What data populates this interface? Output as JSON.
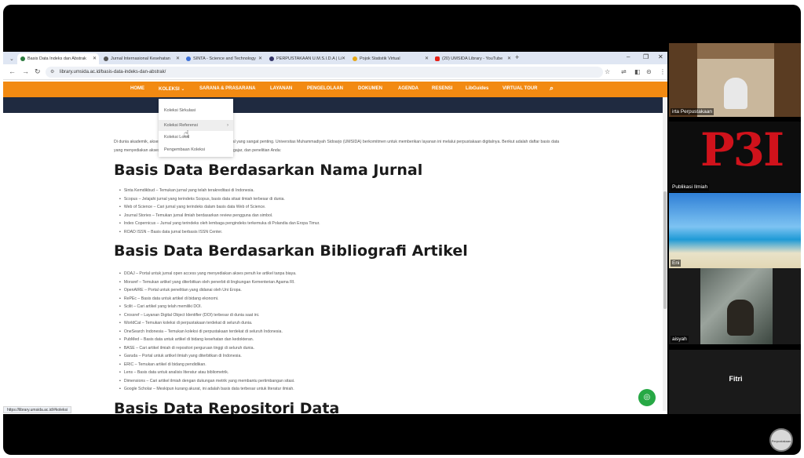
{
  "tabs": [
    {
      "label": "Basis Data Indeks dan Abstrak",
      "active": true,
      "favicon_color": "#2c7a3f"
    },
    {
      "label": "Jurnal Internasional Kesehatan",
      "active": false,
      "favicon_color": "#555555"
    },
    {
      "label": "SINTA - Science and Technology",
      "active": false,
      "favicon_color": "#3a6fd8"
    },
    {
      "label": "PERPUSTAKAAN U.M.S.I.D.A | Li",
      "active": false,
      "favicon_color": "#333366"
    },
    {
      "label": "Pojok Statistik Virtual",
      "active": false,
      "favicon_color": "#e6a817"
    },
    {
      "label": "(20) UMSIDA Library - YouTube",
      "active": false,
      "favicon_color": "#e62117"
    }
  ],
  "address": {
    "url": "library.umsida.ac.id/basis-data-indeks-dan-abstrak/"
  },
  "site": {
    "menu": [
      "HOME",
      "KOLEKSI",
      "SARANA & PRASARANA",
      "LAYANAN",
      "PENGELOLAAN",
      "DOKUMEN",
      "AGENDA",
      "RESENSI",
      "LibGuides",
      "VIRTUAL TOUR"
    ],
    "dropdown": [
      "Koleksi Sirkulasi",
      "Koleksi Referensi",
      "Koleksi Lokal",
      "Pengembaan Koleksi"
    ],
    "intro": "Di dunia akademik, akses terhadap informasi terpercaya adalah hal yang sangat penting. Universitas Muhammadiyah Sidoarjo (UMSIDA) berkomitmen untuk memberikan layanan ini melalui perpustakaan digitalnya. Berikut adalah daftar basis data yang menyediakan akses untuk mendukung kegiatan belajar, mengajar, dan penelitian Anda:",
    "heading1": "Basis Data Berdasarkan Nama Jurnal",
    "list1": [
      "Sinta Kemdikbud – Temukan jurnal yang telah terakreditasi di Indonesia.",
      "Scopus – Jelajahi jurnal yang terindeks Scopus, basis data sitasi ilmiah terbesar di dunia.",
      "Web of Science – Cari jurnal yang terindeks dalam basis data Web of Science.",
      "Journal Stories – Temukan jurnal ilmiah berdasarkan review pengguna dan simbol.",
      "Index Copernicus – Jurnal yang terindeks oleh lembaga pengindeks terkemuka di Polandia dan Eropa Timur.",
      "ROAD ISSN – Basis data jurnal berbasis ISSN Center."
    ],
    "heading2": "Basis Data Berdasarkan Bibliografi Artikel",
    "list2": [
      "DOAJ – Portal untuk jurnal open access yang menyediakan akses penuh ke artikel tanpa biaya.",
      "Moraref – Temukan artikel yang diterbitkan oleh penerbit di lingkungan Kementerian Agama RI.",
      "OpenAIRE – Portal untuk penelitian yang didanai oleh Uni Eropa.",
      "RePEc – Basis data untuk artikel di bidang ekonomi.",
      "Scilit – Cari artikel yang telah memiliki DOI.",
      "Crossref – Layanan Digital Object Identifier (DOI) terbesar di dunia saat ini.",
      "WorldCat – Temukan koleksi di perpustakaan terdekat di seluruh dunia.",
      "OneSearch Indonesia – Temukan koleksi di perpustakaan terdekat di seluruh Indonesia.",
      "PubMed – Basis data untuk artikel di bidang kesehatan dan kedokteran.",
      "BASE – Cari artikel ilmiah di repositori perguruan tinggi di seluruh dunia.",
      "Garuda – Portal untuk artikel ilmiah yang diterbitkan di Indonesia.",
      "ERIC – Temukan artikel di bidang pendidikan.",
      "Lens – Basis data untuk analisis literatur atau bibliometrik.",
      "Dimensions – Cari artikel ilmiah dengan dukungan metrik yang membantu pertimbangan sitasi.",
      "Google Scholar – Meskipun kurang akurat, ini adalah basis data terbesar untuk literatur ilmiah."
    ],
    "heading3": "Basis Data Repositori Data",
    "status_url": "https://library.umsida.ac.id/#koleksi"
  },
  "participants": [
    {
      "name": "irta Perpustakaan"
    },
    {
      "name": "Publikasi Ilmiah",
      "logo": "P3I"
    },
    {
      "name": "Eni"
    },
    {
      "name": "aisyah"
    },
    {
      "name": "Fitri"
    }
  ],
  "selfview_label": "Perpustakaan",
  "colors": {
    "site_orange": "#f28a12",
    "site_navy": "#1f2a40",
    "chat_green": "#27a845",
    "p3i_red": "#d0121b"
  }
}
